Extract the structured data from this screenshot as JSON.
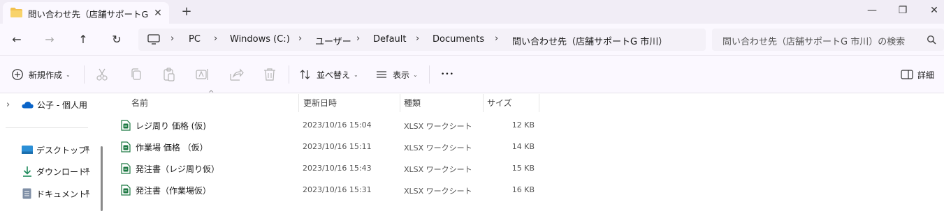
{
  "tab": {
    "title": "問い合わせ先（店舗サポートG 市",
    "close": "✕",
    "new": "+"
  },
  "window": {
    "minimize": "—",
    "restore": "❐",
    "close": "✕"
  },
  "nav": {
    "back": "←",
    "forward": "→",
    "up": "↑",
    "refresh": "↻"
  },
  "breadcrumb": {
    "items": [
      "PC",
      "Windows (C:)",
      "ユーザー",
      "Default",
      "Documents",
      "問い合わせ先（店舗サポートG 市川）"
    ],
    "separator": "›"
  },
  "search": {
    "placeholder": "問い合わせ先（店舗サポートG 市川）の検索"
  },
  "toolbar": {
    "new_label": "新規作成",
    "sort_label": "並べ替え",
    "view_label": "表示",
    "more_label": "•••",
    "details_label": "詳細",
    "dropdown_glyph": "⌄"
  },
  "sidebar": {
    "items": [
      {
        "label": "公子 - 個人用",
        "icon": "onedrive-icon"
      },
      {
        "label": "デスクトップ",
        "icon": "desktop-icon"
      },
      {
        "label": "ダウンロード",
        "icon": "download-icon"
      },
      {
        "label": "ドキュメント",
        "icon": "documents-icon"
      }
    ],
    "expand_glyph": "›"
  },
  "columns": {
    "name": "名前",
    "modified": "更新日時",
    "type": "種類",
    "size": "サイズ",
    "sort_glyph": "^"
  },
  "files": [
    {
      "name": "レジ周り 価格 (仮)",
      "modified": "2023/10/16 15:04",
      "type": "XLSX ワークシート",
      "size": "12 KB"
    },
    {
      "name": "作業場 価格 （仮）",
      "modified": "2023/10/16 15:11",
      "type": "XLSX ワークシート",
      "size": "14 KB"
    },
    {
      "name": "発注書（レジ周り仮）",
      "modified": "2023/10/16 15:43",
      "type": "XLSX ワークシート",
      "size": "15 KB"
    },
    {
      "name": "発注書（作業場仮）",
      "modified": "2023/10/16 15:31",
      "type": "XLSX ワークシート",
      "size": "16 KB"
    }
  ],
  "colors": {
    "accent": "#0067c0",
    "excel_green": "#1f7a44",
    "folder_yellow": "#f2c14e",
    "chrome_bg": "#f1edf6"
  }
}
